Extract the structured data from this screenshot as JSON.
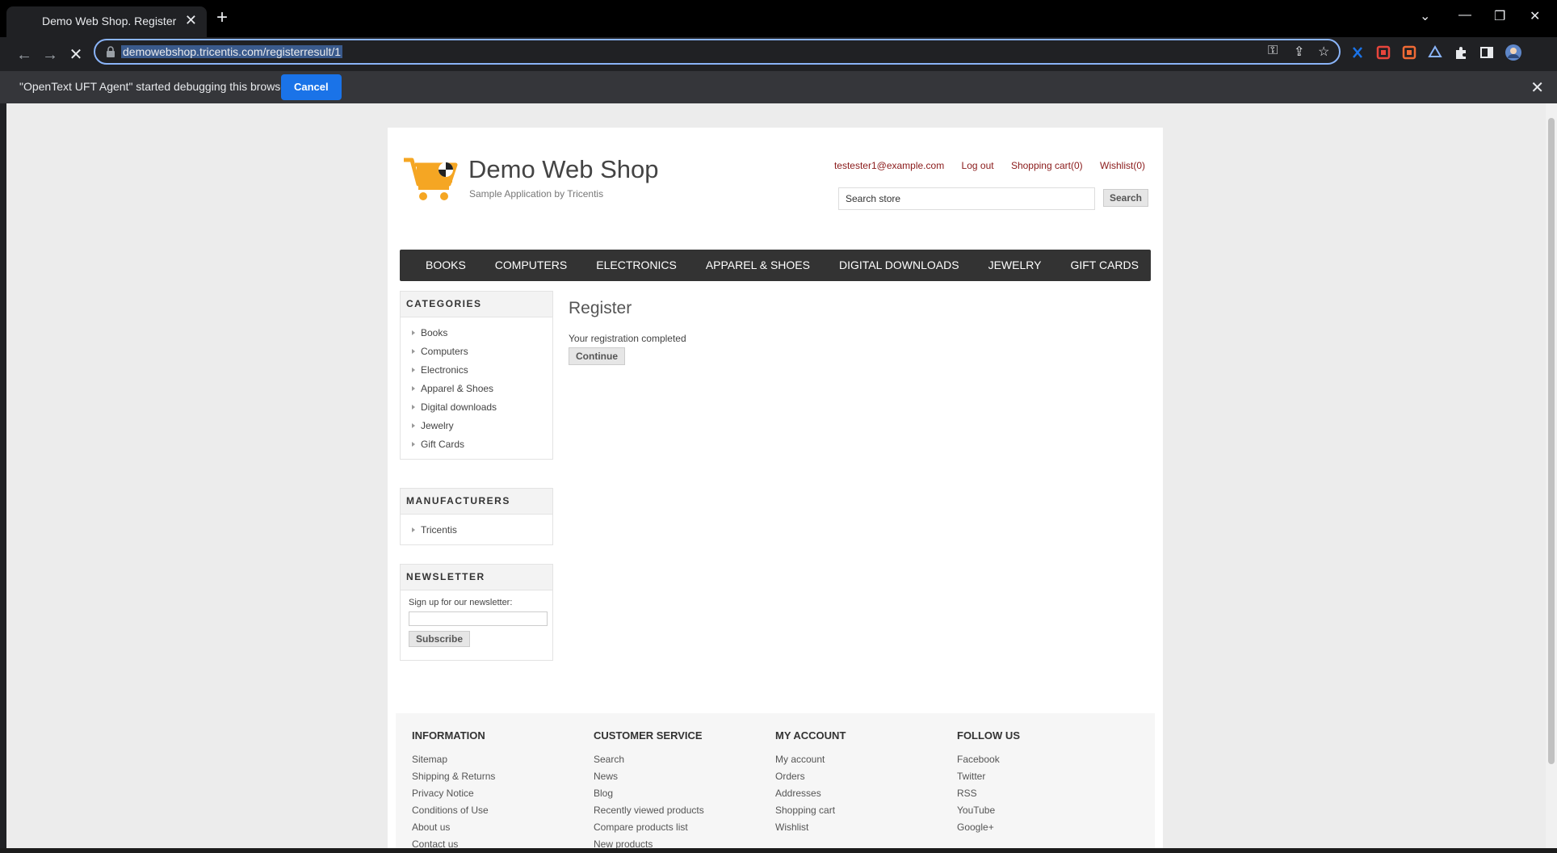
{
  "browser": {
    "tab_title": "Demo Web Shop. Register",
    "url": "demowebshop.tricentis.com/registerresult/1",
    "debug_message": "\"OpenText UFT Agent\" started debugging this browser",
    "debug_cancel": "Cancel"
  },
  "header": {
    "title": "Demo Web Shop",
    "subtitle": "Sample Application by Tricentis",
    "links": {
      "account": "testester1@example.com",
      "logout": "Log out",
      "cart": "Shopping cart(0)",
      "wishlist": "Wishlist(0)"
    },
    "search_value": "Search store",
    "search_button": "Search"
  },
  "menu": [
    "BOOKS",
    "COMPUTERS",
    "ELECTRONICS",
    "APPAREL & SHOES",
    "DIGITAL DOWNLOADS",
    "JEWELRY",
    "GIFT CARDS"
  ],
  "sidebar": {
    "categories_title": "CATEGORIES",
    "categories": [
      "Books",
      "Computers",
      "Electronics",
      "Apparel & Shoes",
      "Digital downloads",
      "Jewelry",
      "Gift Cards"
    ],
    "manufacturers_title": "MANUFACTURERS",
    "manufacturers": [
      "Tricentis"
    ],
    "newsletter_title": "NEWSLETTER",
    "newsletter_label": "Sign up for our newsletter:",
    "newsletter_button": "Subscribe"
  },
  "main": {
    "title": "Register",
    "result": "Your registration completed",
    "continue": "Continue"
  },
  "footer": {
    "information": {
      "title": "INFORMATION",
      "items": [
        "Sitemap",
        "Shipping & Returns",
        "Privacy Notice",
        "Conditions of Use",
        "About us",
        "Contact us"
      ]
    },
    "customer_service": {
      "title": "CUSTOMER SERVICE",
      "items": [
        "Search",
        "News",
        "Blog",
        "Recently viewed products",
        "Compare products list",
        "New products"
      ]
    },
    "my_account": {
      "title": "MY ACCOUNT",
      "items": [
        "My account",
        "Orders",
        "Addresses",
        "Shopping cart",
        "Wishlist"
      ]
    },
    "follow_us": {
      "title": "FOLLOW US",
      "items": [
        "Facebook",
        "Twitter",
        "RSS",
        "YouTube",
        "Google+"
      ]
    }
  },
  "colors": {
    "link": "#8a1a1a",
    "menu_bg": "#333333",
    "logo_orange": "#f5a623",
    "debug_button": "#1a73e8"
  }
}
